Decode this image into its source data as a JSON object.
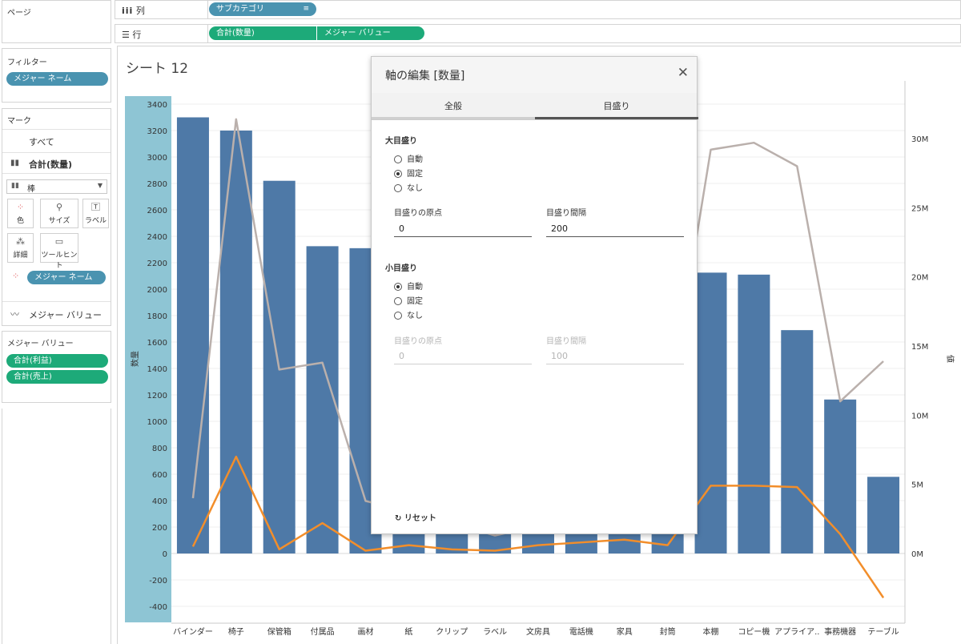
{
  "left": {
    "pages_title": "ページ",
    "filters_title": "フィルター",
    "filter_pill": "メジャー ネーム",
    "marks_title": "マーク",
    "marks_all": "すべて",
    "marks_sum": "合計(数量)",
    "mark_type": "棒",
    "mark_buttons": [
      "色",
      "サイズ",
      "ラベル",
      "詳細",
      "ツールヒント"
    ],
    "color_pill": "メジャー ネーム",
    "measure_values_card": "メジャー バリュー",
    "measure_values_title": "メジャー バリュー",
    "measure_pills": [
      "合計(利益)",
      "合計(売上)"
    ]
  },
  "shelves": {
    "columns_label": "列",
    "columns_pill": "サブカテゴリ",
    "rows_label": "行",
    "rows_pills": [
      "合計(数量)",
      "メジャー バリュー"
    ]
  },
  "sheet_title": "シート 12",
  "dialog": {
    "title": "軸の編集 [数量]",
    "tabs": [
      "全般",
      "目盛り"
    ],
    "active_tab": "目盛り",
    "major": {
      "title": "大目盛り",
      "options": [
        "自動",
        "固定",
        "なし"
      ],
      "selected": "固定",
      "origin_label": "目盛りの原点",
      "origin_value": "0",
      "interval_label": "目盛り間隔",
      "interval_value": "200"
    },
    "minor": {
      "title": "小目盛り",
      "options": [
        "自動",
        "固定",
        "なし"
      ],
      "selected": "自動",
      "origin_label": "目盛りの原点",
      "origin_value": "0",
      "interval_label": "目盛り間隔",
      "interval_value": "100"
    },
    "reset_label": "リセット"
  },
  "chart_data": {
    "type": "bar",
    "categories": [
      "バインダー",
      "椅子",
      "保管箱",
      "付属品",
      "画材",
      "紙",
      "クリップ",
      "ラベル",
      "文房具",
      "電話機",
      "家具",
      "封筒",
      "本棚",
      "コピー機",
      "アプライア..",
      "事務機器",
      "テーブル"
    ],
    "left_axis_label": "数量",
    "left_ticks": [
      "3400",
      "3200",
      "3000",
      "2800",
      "2600",
      "2400",
      "2200",
      "2000",
      "1800",
      "1600",
      "1400",
      "1200",
      "1000",
      "800",
      "600",
      "400",
      "200",
      "0",
      "-200",
      "-400"
    ],
    "right_axis_label": "値",
    "right_ticks": [
      "30M",
      "25M",
      "20M",
      "15M",
      "10M",
      "5M",
      "0M"
    ],
    "series": [
      {
        "name": "合計(数量)",
        "axis": "left",
        "color": "#4e79a7",
        "values": [
          3300,
          3200,
          2820,
          2325,
          2310,
          2300,
          2250,
          2200,
          2150,
          2140,
          2130,
          2125,
          2125,
          2110,
          1690,
          1165,
          580
        ]
      },
      {
        "name": "合計(売上)",
        "axis": "right",
        "color": "#bab0ac",
        "values": [
          4.0,
          31.4,
          13.3,
          13.8,
          3.8,
          3.0,
          2.2,
          1.3,
          2.0,
          2.5,
          2.8,
          10.0,
          29.2,
          29.7,
          28.0,
          11.0,
          13.9
        ]
      },
      {
        "name": "合計(利益)",
        "axis": "right",
        "color": "#f28e2b",
        "values": [
          0.5,
          7.0,
          0.3,
          2.2,
          0.2,
          0.6,
          0.3,
          0.2,
          0.6,
          0.8,
          1.0,
          0.6,
          4.9,
          4.9,
          4.8,
          1.4,
          -3.2
        ]
      }
    ],
    "left_ylim": [
      -500,
      3500
    ],
    "right_ylim": [
      -5,
      33
    ],
    "grid": true,
    "legend": "none"
  }
}
